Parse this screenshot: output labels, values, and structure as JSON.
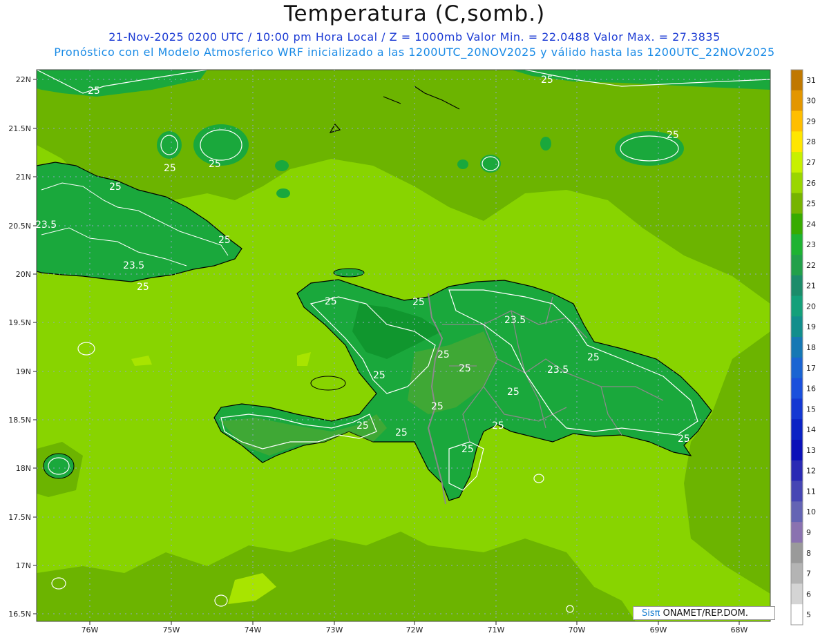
{
  "header": {
    "title": "Temperatura (C,somb.)",
    "subtitle_line1": "21-Nov-2025 0200 UTC / 10:00 pm Hora Local / Z = 1000mb  Valor Min. = 22.0488  Valor Max. = 27.3835",
    "subtitle_line2": "Pronóstico con el Modelo Atmosferico WRF inicializado a las 1200UTC_20NOV2025 y válido hasta las  1200UTC_22NOV2025"
  },
  "axes": {
    "lat_labels": [
      "22N",
      "21.5N",
      "21N",
      "20.5N",
      "20N",
      "19.5N",
      "19N",
      "18.5N",
      "18N",
      "17.5N",
      "17N",
      "16.5N"
    ],
    "lon_labels": [
      "76W",
      "75W",
      "74W",
      "73W",
      "72W",
      "71W",
      "70W",
      "69W",
      "68W"
    ]
  },
  "contour_labels": [
    "25",
    "25",
    "25",
    "25",
    "23.5",
    "25",
    "23.5",
    "25",
    "25",
    "25",
    "25",
    "25",
    "23.5",
    "25",
    "25",
    "23.5",
    "25",
    "25",
    "25",
    "25",
    "25",
    "25",
    "25",
    "25",
    "25"
  ],
  "colorbar": {
    "labels": [
      "31",
      "30",
      "29",
      "28",
      "27",
      "26",
      "25",
      "24",
      "23",
      "22",
      "21",
      "20",
      "19",
      "18",
      "17",
      "16",
      "15",
      "14",
      "13",
      "12",
      "11",
      "10",
      "9",
      "8",
      "7",
      "6",
      "5"
    ],
    "colors": [
      "#c07800",
      "#e39600",
      "#ffbe00",
      "#ffe600",
      "#c8f000",
      "#9ad600",
      "#76b400",
      "#38ab00",
      "#1eb332",
      "#22a04a",
      "#1c8c6a",
      "#14a07a",
      "#128e8c",
      "#1678b4",
      "#1a64d2",
      "#1a50dc",
      "#1438d2",
      "#0a22c4",
      "#0a10b8",
      "#2a2ab4",
      "#4646b4",
      "#6464b4",
      "#8a72b0",
      "#9a9a9a",
      "#b4b4b4",
      "#d4d4d4",
      "#ffffff"
    ]
  },
  "map_colors": {
    "sea_light": "#88d400",
    "sea_dark": "#6cb400",
    "land": "#1aa83c",
    "land_dark": "#10962e",
    "yellow": "#a8e400",
    "border": "#8a8a8a",
    "coast": "#000000",
    "contour": "#ffffff"
  },
  "credit": {
    "brand": "Sisπ",
    "text": " ONAMET/REP.DOM."
  }
}
